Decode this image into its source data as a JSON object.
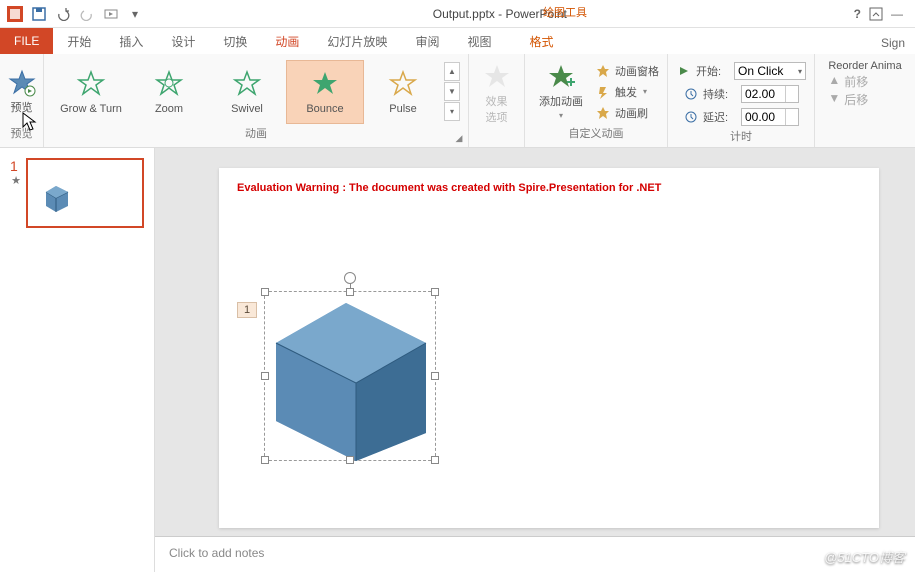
{
  "titlebar": {
    "title": "Output.pptx - PowerPoint",
    "contextTools": "绘图工具"
  },
  "tabs": {
    "file": "FILE",
    "items": [
      "开始",
      "插入",
      "设计",
      "切换",
      "动画",
      "幻灯片放映",
      "审阅",
      "视图"
    ],
    "active": "动画",
    "context": "格式",
    "sign": "Sign"
  },
  "ribbon": {
    "preview": {
      "label": "预览",
      "group": "预览"
    },
    "gallery": {
      "items": [
        {
          "label": "Grow & Turn"
        },
        {
          "label": "Zoom"
        },
        {
          "label": "Swivel"
        },
        {
          "label": "Bounce",
          "selected": true
        },
        {
          "label": "Pulse"
        }
      ],
      "group": "动画"
    },
    "effectOptions": "效果选项",
    "addAnimation": "添加动画",
    "customGroup": "自定义动画",
    "custom": {
      "pane": "动画窗格",
      "trigger": "触发",
      "painter": "动画刷"
    },
    "timing": {
      "start": {
        "label": "开始:",
        "value": "On Click"
      },
      "duration": {
        "label": "持续:",
        "value": "02.00"
      },
      "delay": {
        "label": "延迟:",
        "value": "00.00"
      },
      "group": "计时"
    },
    "reorder": {
      "title": "Reorder Anima",
      "fwd": "前移",
      "back": "后移"
    }
  },
  "slides": {
    "current": "1"
  },
  "canvas": {
    "warning": "Evaluation Warning : The document was created with  Spire.Presentation for .NET",
    "animTag": "1"
  },
  "notes": {
    "placeholder": "Click to add notes"
  },
  "watermark": "@51CTO博客"
}
